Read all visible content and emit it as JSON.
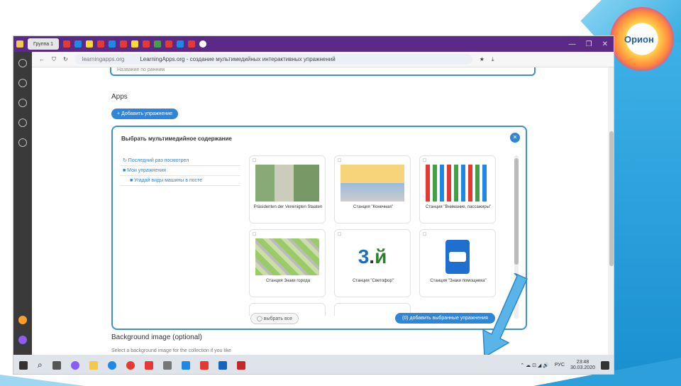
{
  "browser": {
    "tab_label": "Группа 1",
    "url_host": "learningapps.org",
    "page_title": "LearningApps.org - создание мультимедийных интерактивных упражнений",
    "win_controls": [
      "—",
      "❐",
      "✕"
    ]
  },
  "page": {
    "top_field_text": "Название по ранним",
    "apps_heading": "Apps",
    "add_button": "+ Добавить упражнение",
    "background_heading": "Background image (optional)",
    "background_hint": "Select a background image for the collection if you like"
  },
  "dialog": {
    "title": "Выбрать мультимедийное содержание",
    "close": "✕",
    "tree": [
      {
        "label": "↻ Последний раз посмотрел"
      },
      {
        "label": "■ Мои упражнения"
      },
      {
        "label": "■ Угадай виды машины в посте"
      }
    ],
    "cards": [
      {
        "caption": "Präsidenten der Vereinigten Staaten"
      },
      {
        "caption": "Станция \"Конечная\""
      },
      {
        "caption": "Станция \"Внимание, пассажиры\""
      },
      {
        "caption": "Станция Знаки города"
      },
      {
        "caption": "Станция \"Светофор\""
      },
      {
        "caption": "Станция \"Знаки помощника\""
      }
    ],
    "select_all": "◯ выбрать все",
    "add_selected": "(0) добавить выбранные упражнения"
  },
  "taskbar": {
    "lang": "РУС",
    "time": "23:48",
    "date": "30.03.2020"
  },
  "logo_text": "Орион",
  "colors": {
    "accent": "#2f86d6",
    "tabbar": "#5b2a86"
  }
}
